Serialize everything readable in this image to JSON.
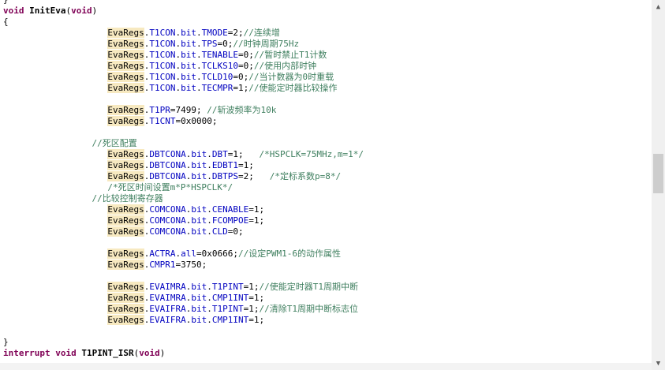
{
  "editor": {
    "lines": [
      {
        "indent": 0,
        "tokens": [
          {
            "t": "}",
            "c": "pl"
          }
        ]
      },
      {
        "indent": 0,
        "tokens": [
          {
            "t": "void",
            "c": "kw"
          },
          {
            "t": " ",
            "c": "pl"
          },
          {
            "t": "InitEva",
            "c": "fn"
          },
          {
            "t": "(",
            "c": "pl"
          },
          {
            "t": "void",
            "c": "kw"
          },
          {
            "t": ")",
            "c": "pl"
          }
        ]
      },
      {
        "indent": 0,
        "tokens": [
          {
            "t": "{",
            "c": "pl"
          }
        ]
      },
      {
        "indent": 20,
        "tokens": [
          {
            "t": "EvaRegs",
            "c": "obj"
          },
          {
            "t": ".",
            "c": "pl"
          },
          {
            "t": "T1CON",
            "c": "fld"
          },
          {
            "t": ".",
            "c": "pl"
          },
          {
            "t": "bit",
            "c": "fld"
          },
          {
            "t": ".",
            "c": "pl"
          },
          {
            "t": "TMODE",
            "c": "fld"
          },
          {
            "t": "=2;",
            "c": "pl"
          },
          {
            "t": "//连续增",
            "c": "cm"
          }
        ]
      },
      {
        "indent": 20,
        "tokens": [
          {
            "t": "EvaRegs",
            "c": "obj"
          },
          {
            "t": ".",
            "c": "pl"
          },
          {
            "t": "T1CON",
            "c": "fld"
          },
          {
            "t": ".",
            "c": "pl"
          },
          {
            "t": "bit",
            "c": "fld"
          },
          {
            "t": ".",
            "c": "pl"
          },
          {
            "t": "TPS",
            "c": "fld"
          },
          {
            "t": "=0;",
            "c": "pl"
          },
          {
            "t": "//时钟周期75Hz",
            "c": "cm"
          }
        ]
      },
      {
        "indent": 20,
        "tokens": [
          {
            "t": "EvaRegs",
            "c": "obj"
          },
          {
            "t": ".",
            "c": "pl"
          },
          {
            "t": "T1CON",
            "c": "fld"
          },
          {
            "t": ".",
            "c": "pl"
          },
          {
            "t": "bit",
            "c": "fld"
          },
          {
            "t": ".",
            "c": "pl"
          },
          {
            "t": "TENABLE",
            "c": "fld"
          },
          {
            "t": "=0;",
            "c": "pl"
          },
          {
            "t": "//暂时禁止T1计数",
            "c": "cm"
          }
        ]
      },
      {
        "indent": 20,
        "tokens": [
          {
            "t": "EvaRegs",
            "c": "obj"
          },
          {
            "t": ".",
            "c": "pl"
          },
          {
            "t": "T1CON",
            "c": "fld"
          },
          {
            "t": ".",
            "c": "pl"
          },
          {
            "t": "bit",
            "c": "fld"
          },
          {
            "t": ".",
            "c": "pl"
          },
          {
            "t": "TCLKS10",
            "c": "fld"
          },
          {
            "t": "=0;",
            "c": "pl"
          },
          {
            "t": "//使用内部时钟",
            "c": "cm"
          }
        ]
      },
      {
        "indent": 20,
        "tokens": [
          {
            "t": "EvaRegs",
            "c": "obj"
          },
          {
            "t": ".",
            "c": "pl"
          },
          {
            "t": "T1CON",
            "c": "fld"
          },
          {
            "t": ".",
            "c": "pl"
          },
          {
            "t": "bit",
            "c": "fld"
          },
          {
            "t": ".",
            "c": "pl"
          },
          {
            "t": "TCLD10",
            "c": "fld"
          },
          {
            "t": "=0;",
            "c": "pl"
          },
          {
            "t": "//当计数器为0时重载",
            "c": "cm"
          }
        ]
      },
      {
        "indent": 20,
        "tokens": [
          {
            "t": "EvaRegs",
            "c": "obj"
          },
          {
            "t": ".",
            "c": "pl"
          },
          {
            "t": "T1CON",
            "c": "fld"
          },
          {
            "t": ".",
            "c": "pl"
          },
          {
            "t": "bit",
            "c": "fld"
          },
          {
            "t": ".",
            "c": "pl"
          },
          {
            "t": "TECMPR",
            "c": "fld"
          },
          {
            "t": "=1;",
            "c": "pl"
          },
          {
            "t": "//使能定时器比较操作",
            "c": "cm"
          }
        ]
      },
      {
        "indent": 0,
        "tokens": []
      },
      {
        "indent": 20,
        "tokens": [
          {
            "t": "EvaRegs",
            "c": "obj"
          },
          {
            "t": ".",
            "c": "pl"
          },
          {
            "t": "T1PR",
            "c": "fld"
          },
          {
            "t": "=7499; ",
            "c": "pl"
          },
          {
            "t": "//斩波频率为10k",
            "c": "cm"
          }
        ]
      },
      {
        "indent": 20,
        "tokens": [
          {
            "t": "EvaRegs",
            "c": "obj"
          },
          {
            "t": ".",
            "c": "pl"
          },
          {
            "t": "T1CNT",
            "c": "fld"
          },
          {
            "t": "=0x0000;",
            "c": "pl"
          }
        ]
      },
      {
        "indent": 0,
        "tokens": []
      },
      {
        "indent": 17,
        "tokens": [
          {
            "t": "//死区配置",
            "c": "cm"
          }
        ]
      },
      {
        "indent": 20,
        "tokens": [
          {
            "t": "EvaRegs",
            "c": "obj"
          },
          {
            "t": ".",
            "c": "pl"
          },
          {
            "t": "DBTCONA",
            "c": "fld"
          },
          {
            "t": ".",
            "c": "pl"
          },
          {
            "t": "bit",
            "c": "fld"
          },
          {
            "t": ".",
            "c": "pl"
          },
          {
            "t": "DBT",
            "c": "fld"
          },
          {
            "t": "=1;   ",
            "c": "pl"
          },
          {
            "t": "/*HSPCLK=75MHz,m=1*/",
            "c": "cm"
          }
        ]
      },
      {
        "indent": 20,
        "tokens": [
          {
            "t": "EvaRegs",
            "c": "obj"
          },
          {
            "t": ".",
            "c": "pl"
          },
          {
            "t": "DBTCONA",
            "c": "fld"
          },
          {
            "t": ".",
            "c": "pl"
          },
          {
            "t": "bit",
            "c": "fld"
          },
          {
            "t": ".",
            "c": "pl"
          },
          {
            "t": "EDBT1",
            "c": "fld"
          },
          {
            "t": "=1;",
            "c": "pl"
          }
        ]
      },
      {
        "indent": 20,
        "tokens": [
          {
            "t": "EvaRegs",
            "c": "obj"
          },
          {
            "t": ".",
            "c": "pl"
          },
          {
            "t": "DBTCONA",
            "c": "fld"
          },
          {
            "t": ".",
            "c": "pl"
          },
          {
            "t": "bit",
            "c": "fld"
          },
          {
            "t": ".",
            "c": "pl"
          },
          {
            "t": "DBTPS",
            "c": "fld"
          },
          {
            "t": "=2;   ",
            "c": "pl"
          },
          {
            "t": "/*定标系数p=8*/",
            "c": "cm"
          }
        ]
      },
      {
        "indent": 20,
        "tokens": [
          {
            "t": "/*死区时间设置m*P*HSPCLK*/",
            "c": "cm"
          }
        ]
      },
      {
        "indent": 17,
        "tokens": [
          {
            "t": "//比较控制寄存器",
            "c": "cm"
          }
        ]
      },
      {
        "indent": 20,
        "tokens": [
          {
            "t": "EvaRegs",
            "c": "obj"
          },
          {
            "t": ".",
            "c": "pl"
          },
          {
            "t": "COMCONA",
            "c": "fld"
          },
          {
            "t": ".",
            "c": "pl"
          },
          {
            "t": "bit",
            "c": "fld"
          },
          {
            "t": ".",
            "c": "pl"
          },
          {
            "t": "CENABLE",
            "c": "fld"
          },
          {
            "t": "=1;",
            "c": "pl"
          }
        ]
      },
      {
        "indent": 20,
        "tokens": [
          {
            "t": "EvaRegs",
            "c": "obj"
          },
          {
            "t": ".",
            "c": "pl"
          },
          {
            "t": "COMCONA",
            "c": "fld"
          },
          {
            "t": ".",
            "c": "pl"
          },
          {
            "t": "bit",
            "c": "fld"
          },
          {
            "t": ".",
            "c": "pl"
          },
          {
            "t": "FCOMPOE",
            "c": "fld"
          },
          {
            "t": "=1;",
            "c": "pl"
          }
        ]
      },
      {
        "indent": 20,
        "tokens": [
          {
            "t": "EvaRegs",
            "c": "obj"
          },
          {
            "t": ".",
            "c": "pl"
          },
          {
            "t": "COMCONA",
            "c": "fld"
          },
          {
            "t": ".",
            "c": "pl"
          },
          {
            "t": "bit",
            "c": "fld"
          },
          {
            "t": ".",
            "c": "pl"
          },
          {
            "t": "CLD",
            "c": "fld"
          },
          {
            "t": "=0;",
            "c": "pl"
          }
        ]
      },
      {
        "indent": 0,
        "tokens": []
      },
      {
        "indent": 20,
        "tokens": [
          {
            "t": "EvaRegs",
            "c": "obj"
          },
          {
            "t": ".",
            "c": "pl"
          },
          {
            "t": "ACTRA",
            "c": "fld"
          },
          {
            "t": ".",
            "c": "pl"
          },
          {
            "t": "all",
            "c": "fld"
          },
          {
            "t": "=0x0666;",
            "c": "pl"
          },
          {
            "t": "//设定PWM1-6的动作属性",
            "c": "cm"
          }
        ]
      },
      {
        "indent": 20,
        "tokens": [
          {
            "t": "EvaRegs",
            "c": "obj"
          },
          {
            "t": ".",
            "c": "pl"
          },
          {
            "t": "CMPR1",
            "c": "fld"
          },
          {
            "t": "=3750;",
            "c": "pl"
          }
        ]
      },
      {
        "indent": 0,
        "tokens": []
      },
      {
        "indent": 20,
        "tokens": [
          {
            "t": "EvaRegs",
            "c": "obj"
          },
          {
            "t": ".",
            "c": "pl"
          },
          {
            "t": "EVAIMRA",
            "c": "fld"
          },
          {
            "t": ".",
            "c": "pl"
          },
          {
            "t": "bit",
            "c": "fld"
          },
          {
            "t": ".",
            "c": "pl"
          },
          {
            "t": "T1PINT",
            "c": "fld"
          },
          {
            "t": "=1;",
            "c": "pl"
          },
          {
            "t": "//使能定时器T1周期中断",
            "c": "cm"
          }
        ]
      },
      {
        "indent": 20,
        "tokens": [
          {
            "t": "EvaRegs",
            "c": "obj"
          },
          {
            "t": ".",
            "c": "pl"
          },
          {
            "t": "EVAIMRA",
            "c": "fld"
          },
          {
            "t": ".",
            "c": "pl"
          },
          {
            "t": "bit",
            "c": "fld"
          },
          {
            "t": ".",
            "c": "pl"
          },
          {
            "t": "CMP1INT",
            "c": "fld"
          },
          {
            "t": "=1;",
            "c": "pl"
          }
        ]
      },
      {
        "indent": 20,
        "tokens": [
          {
            "t": "EvaRegs",
            "c": "obj"
          },
          {
            "t": ".",
            "c": "pl"
          },
          {
            "t": "EVAIFRA",
            "c": "fld"
          },
          {
            "t": ".",
            "c": "pl"
          },
          {
            "t": "bit",
            "c": "fld"
          },
          {
            "t": ".",
            "c": "pl"
          },
          {
            "t": "T1PINT",
            "c": "fld"
          },
          {
            "t": "=1;",
            "c": "pl"
          },
          {
            "t": "//清除T1周期中断标志位",
            "c": "cm"
          }
        ]
      },
      {
        "indent": 20,
        "tokens": [
          {
            "t": "EvaRegs",
            "c": "obj"
          },
          {
            "t": ".",
            "c": "pl"
          },
          {
            "t": "EVAIFRA",
            "c": "fld"
          },
          {
            "t": ".",
            "c": "pl"
          },
          {
            "t": "bit",
            "c": "fld"
          },
          {
            "t": ".",
            "c": "pl"
          },
          {
            "t": "CMP1INT",
            "c": "fld"
          },
          {
            "t": "=1;",
            "c": "pl"
          }
        ]
      },
      {
        "indent": 0,
        "tokens": []
      },
      {
        "indent": 0,
        "tokens": [
          {
            "t": "}",
            "c": "pl"
          }
        ]
      },
      {
        "indent": 0,
        "tokens": [
          {
            "t": "interrupt",
            "c": "kw"
          },
          {
            "t": " ",
            "c": "pl"
          },
          {
            "t": "void",
            "c": "kw"
          },
          {
            "t": " ",
            "c": "pl"
          },
          {
            "t": "T1PINT_ISR",
            "c": "fn"
          },
          {
            "t": "(",
            "c": "pl"
          },
          {
            "t": "void",
            "c": "kw"
          },
          {
            "t": ")",
            "c": "pl"
          }
        ]
      }
    ]
  },
  "scrollbar": {
    "up_icon": "chevron-up-icon",
    "down_icon": "chevron-down-icon"
  }
}
